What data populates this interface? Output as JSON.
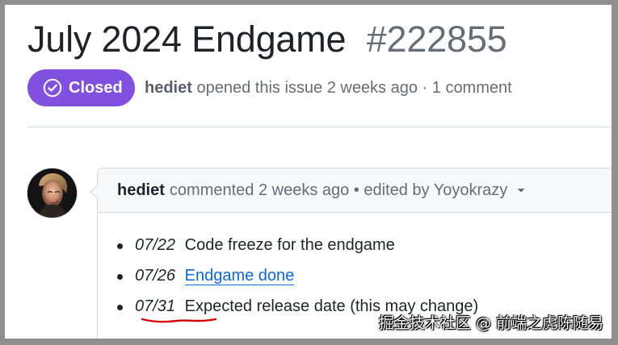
{
  "issue": {
    "title": "July 2024 Endgame",
    "number": "#222855",
    "status": "Closed",
    "author": "hediet",
    "meta": "opened this issue 2 weeks ago · 1 comment"
  },
  "comment": {
    "author": "hediet",
    "meta": "commented 2 weeks ago • edited by Yoyokrazy",
    "items": [
      {
        "date": "07/22",
        "text": "Code freeze for the endgame"
      },
      {
        "date": "07/26",
        "link_text": "Endgame done"
      },
      {
        "date": "07/31",
        "text": "Expected release date (this may change)"
      }
    ]
  },
  "watermark": "掘金技术社区 @ 前端之虎陈随易",
  "colors": {
    "closed_badge": "#8250df",
    "link": "#0969da",
    "annotation": "#d40000"
  },
  "icons": {
    "status": "closed-check-circle-icon",
    "menu": "chevron-down-icon"
  }
}
